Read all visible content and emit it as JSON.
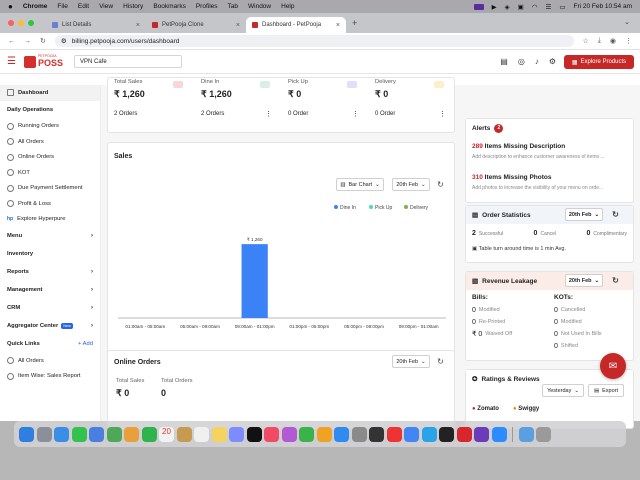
{
  "menubar": {
    "apple": "",
    "items": [
      "Chrome",
      "File",
      "Edit",
      "View",
      "History",
      "Bookmarks",
      "Profiles",
      "Tab",
      "Window",
      "Help"
    ],
    "datetime": "Fri 20 Feb  10:54 am"
  },
  "browser": {
    "tabs": [
      {
        "title": "List Details"
      },
      {
        "title": "PetPooja Clone"
      },
      {
        "title": "Dashboard - PetPooja"
      }
    ],
    "new_tab": "+",
    "url": "billing.petpooja.com/users/dashboard"
  },
  "header": {
    "logo_small": "PETPOOJA",
    "logo_big": "POSS",
    "outlet": "VPN Cafe",
    "explore_label": "Explore Products"
  },
  "sidebar": {
    "dashboard": "Dashboard",
    "daily_ops_title": "Daily Operations",
    "daily_ops": [
      "Running Orders",
      "All Orders",
      "Online Orders",
      "KOT",
      "Due Payment Settlement",
      "Profit & Loss"
    ],
    "hp_logo": "hp",
    "hyperpure": "Explore Hyperpure",
    "sections": [
      "Menu",
      "Inventory",
      "Reports",
      "Management",
      "CRM"
    ],
    "aggregator": "Aggregator Center",
    "new_badge": "New",
    "quick_links_title": "Quick Links",
    "add_label": "+ Add",
    "quick_links": [
      "All Orders",
      "Item Wise: Sales Report"
    ]
  },
  "stats": [
    {
      "label": "Total Sales",
      "value": "₹ 1,260",
      "orders": "2 Orders",
      "box_color": "#f8d7da"
    },
    {
      "label": "Dine In",
      "value": "₹ 1,260",
      "orders": "2 Orders",
      "box_color": "#d8f0e3"
    },
    {
      "label": "Pick Up",
      "value": "₹ 0",
      "orders": "0 Order",
      "box_color": "#e5dcf8"
    },
    {
      "label": "Delivery",
      "value": "₹ 0",
      "orders": "0 Order",
      "box_color": "#fbf0c9"
    }
  ],
  "sales": {
    "title": "Sales",
    "chart_type_label": "Bar Chart",
    "date_label": "20th Feb"
  },
  "chart_data": {
    "type": "bar",
    "categories": [
      "01:00am - 05:00am",
      "05:00am - 09:00am",
      "09:00am - 01:00pm",
      "01:00pm - 05:00pm",
      "05:00pm - 09:00pm",
      "09:00pm - 01:00am"
    ],
    "series": [
      {
        "name": "Dine In",
        "color": "#3b82f6",
        "values": [
          0,
          0,
          1260,
          0,
          0,
          0
        ]
      },
      {
        "name": "Pick Up",
        "color": "#4dd9b5",
        "values": [
          0,
          0,
          0,
          0,
          0,
          0
        ]
      },
      {
        "name": "Delivery",
        "color": "#7cb342",
        "values": [
          0,
          0,
          0,
          0,
          0,
          0
        ]
      }
    ],
    "data_labels": [
      "",
      "",
      "₹ 1,260",
      "",
      "",
      ""
    ],
    "ylim": [
      0,
      1450
    ],
    "grid": false,
    "legend": "top-right"
  },
  "online": {
    "title": "Online Orders",
    "date_label": "20th Feb",
    "total_sales_label": "Total Sales",
    "total_sales_value": "₹ 0",
    "total_orders_label": "Total Orders",
    "total_orders_value": "0"
  },
  "alerts": {
    "title": "Alerts",
    "count": "2",
    "items": [
      {
        "count": "289",
        "text": "Items Missing Description",
        "sub": "Add description to enhance customer awareness of items ..."
      },
      {
        "count": "310",
        "text": "Items Missing Photos",
        "sub": "Add photos to increase the visibility of your menu on orde..."
      }
    ]
  },
  "order_stats": {
    "title": "Order Statistics",
    "date_label": "20th Feb",
    "successful": "2",
    "successful_label": "Successful",
    "cancel": "0",
    "cancel_label": "Cancel",
    "complimentary": "0",
    "complimentary_label": "Complimentary",
    "tat": "Table turn around time is 1 min Avg."
  },
  "revenue_leakage": {
    "title": "Revenue Leakage",
    "date_label": "20th Feb",
    "bills_title": "Bills:",
    "bills": [
      {
        "n": "0",
        "label": "Modified"
      },
      {
        "n": "0",
        "label": "Re-Printed"
      },
      {
        "n": "₹ 0",
        "label": "Waived Off"
      }
    ],
    "kots_title": "KOTs:",
    "kots": [
      {
        "n": "0",
        "label": "Cancelled"
      },
      {
        "n": "0",
        "label": "Modified"
      },
      {
        "n": "0",
        "label": "Not Used In Bills"
      },
      {
        "n": "0",
        "label": "Shifted"
      }
    ]
  },
  "ratings": {
    "title": "Ratings & Reviews",
    "period_label": "Yesterday",
    "export_label": "Export",
    "sources": [
      "Zomato",
      "Swiggy"
    ]
  },
  "colors": {
    "brand": "#c62828",
    "bar": "#3b82f6"
  }
}
